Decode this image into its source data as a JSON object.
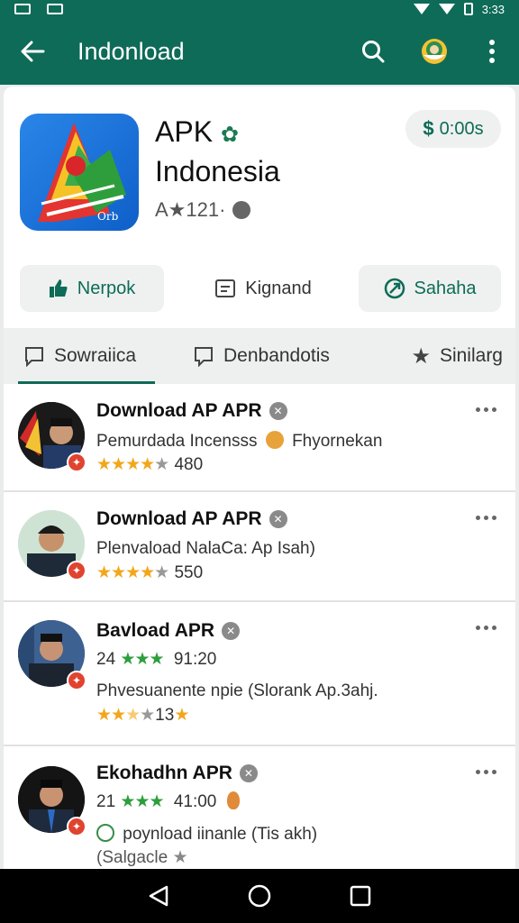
{
  "status": {
    "time": "3:33"
  },
  "appbar": {
    "title": "Indonload"
  },
  "app": {
    "name_line1": "APK",
    "name_line2": "Indonesia",
    "meta": "A★121·",
    "price": "0:00s",
    "icon_text": "Orb"
  },
  "actions": [
    {
      "label": "Nerpok"
    },
    {
      "label": "Kignand"
    },
    {
      "label": "Sahaha"
    }
  ],
  "tabs": [
    {
      "label": "Sowraiica"
    },
    {
      "label": "Denbandotis"
    },
    {
      "label": "Sinilarg"
    }
  ],
  "items": [
    {
      "title": "Download AP APR",
      "line1": "Pemurdada Incensss",
      "line1_extra": "Fhyornekan",
      "rating_stars": "★★★★",
      "rating_grey": "★",
      "rating_value": "480"
    },
    {
      "title": "Download AP APR",
      "line1": "Plenvaload NalaCa: Ap Isah)",
      "rating_stars": "★★★★",
      "rating_grey": "★",
      "rating_value": "550"
    },
    {
      "title": "Bavload APR",
      "line_prefix": "24",
      "line_stars": "★★★",
      "line_value": "91:20",
      "line2": "Phvesuanente npie (Slorank Ap.3ahj.",
      "rating_stars": "★★",
      "rating_half": "★",
      "rating_grey": "★",
      "rating_value": "13",
      "rating_tail": "★"
    },
    {
      "title": "Ekohadhn APR",
      "line_prefix": "21",
      "line_stars": "★★★",
      "line_value": "41:00",
      "line2": "poynload iinanle (Tis akh)",
      "line3": "(Salgacle"
    }
  ]
}
